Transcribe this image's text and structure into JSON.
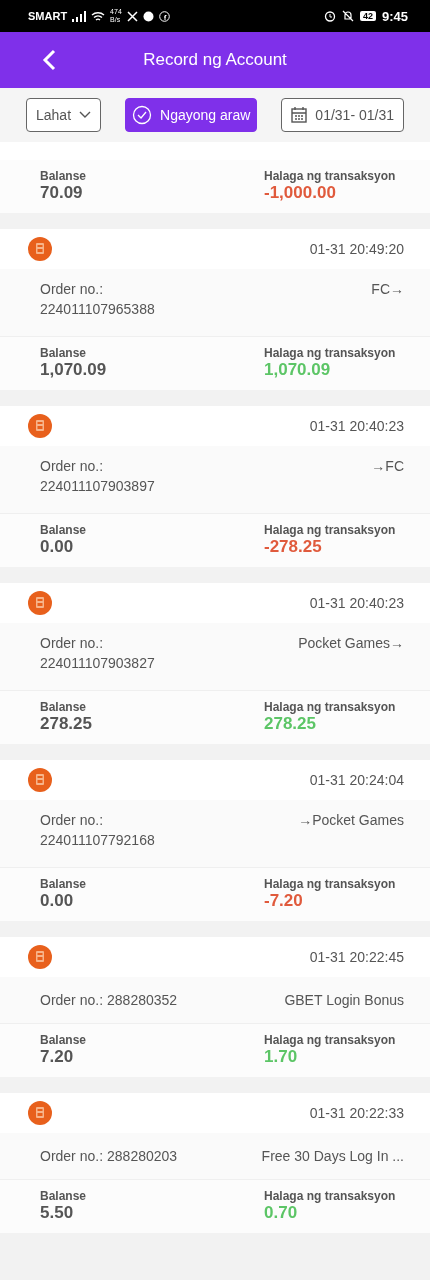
{
  "status_bar": {
    "carrier": "SMART",
    "speed_value": "474",
    "speed_unit": "B/s",
    "battery": "42",
    "time": "9:45"
  },
  "header": {
    "title": "Record ng Account"
  },
  "filters": {
    "type": "Lahat",
    "today": {
      "label": "Ngayong araw",
      "selected": true
    },
    "date_range": "01/31- 01/31"
  },
  "partial_record": {
    "balance_label": "Balanse",
    "balance": "70.09",
    "amount_label": "Halaga ng transaksyon",
    "amount": "-1,000.00",
    "kind": "debit"
  },
  "records": [
    {
      "time": "01-31 20:49:20",
      "order_label": "Order no.:",
      "order_no": "224011107965388",
      "wrap": true,
      "description": "FC→",
      "balance_label": "Balanse",
      "balance": "1,070.09",
      "amount_label": "Halaga ng transaksyon",
      "amount": "1,070.09",
      "kind": "credit"
    },
    {
      "time": "01-31 20:40:23",
      "order_label": "Order no.:",
      "order_no": "224011107903897",
      "wrap": true,
      "description": "→FC",
      "balance_label": "Balanse",
      "balance": "0.00",
      "amount_label": "Halaga ng transaksyon",
      "amount": "-278.25",
      "kind": "debit"
    },
    {
      "time": "01-31 20:40:23",
      "order_label": "Order no.:",
      "order_no": "224011107903827",
      "wrap": true,
      "description": "Pocket Games→",
      "balance_label": "Balanse",
      "balance": "278.25",
      "amount_label": "Halaga ng transaksyon",
      "amount": "278.25",
      "kind": "credit"
    },
    {
      "time": "01-31 20:24:04",
      "order_label": "Order no.:",
      "order_no": "224011107792168",
      "wrap": true,
      "description": "→Pocket Games",
      "balance_label": "Balanse",
      "balance": "0.00",
      "amount_label": "Halaga ng transaksyon",
      "amount": "-7.20",
      "kind": "debit"
    },
    {
      "time": "01-31 20:22:45",
      "order_label": "Order no.:",
      "order_no": "288280352",
      "wrap": false,
      "description": "GBET Login Bonus",
      "balance_label": "Balanse",
      "balance": "7.20",
      "amount_label": "Halaga ng transaksyon",
      "amount": "1.70",
      "kind": "credit"
    },
    {
      "time": "01-31 20:22:33",
      "order_label": "Order no.:",
      "order_no": "288280203",
      "wrap": false,
      "description": "Free 30 Days Log In ...",
      "balance_label": "Balanse",
      "balance": "5.50",
      "amount_label": "Halaga ng transaksyon",
      "amount": "0.70",
      "kind": "credit"
    }
  ]
}
